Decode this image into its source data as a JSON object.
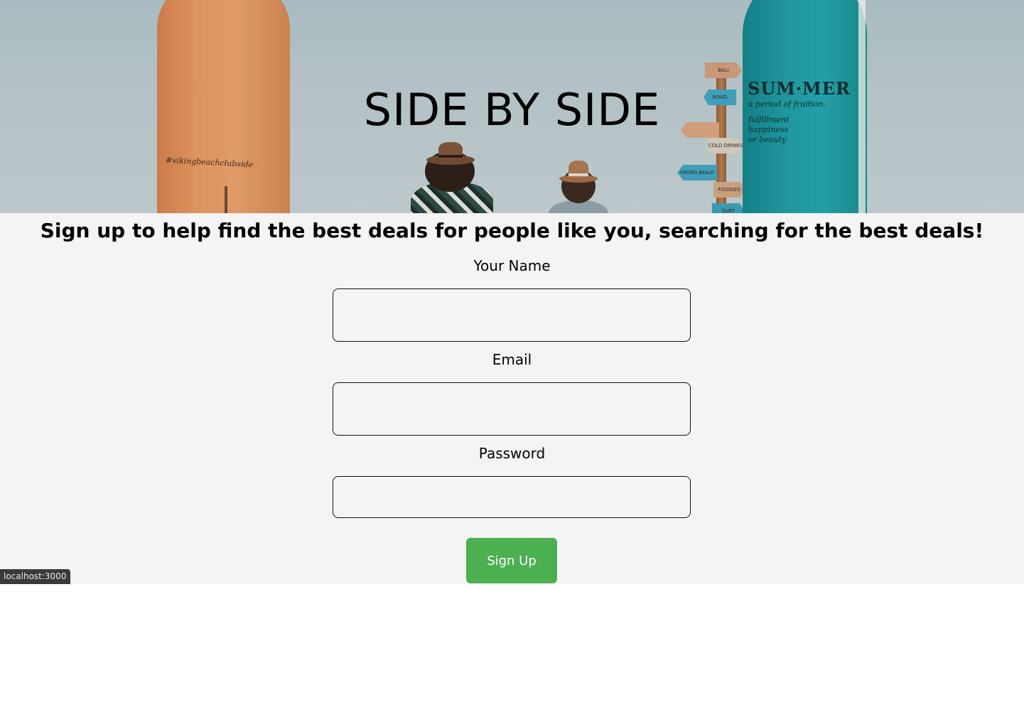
{
  "hero": {
    "title": "SIDE BY SIDE",
    "left_board_text": "#vikingbeachclubside",
    "right_board": {
      "title": "SUM·MER",
      "lines": [
        "a period of fruition.",
        "fulfillment",
        "happiness",
        "or beauty"
      ]
    },
    "signs": [
      "BALI",
      "ROAD",
      "COLD DRINKS",
      "VIKING Beach",
      "FOODIES",
      "SURF"
    ]
  },
  "signup": {
    "tagline": "Sign up to help find the best deals for people like you, searching for the best deals!",
    "name_label": "Your Name",
    "name_value": "",
    "email_label": "Email",
    "email_value": "",
    "password_label": "Password",
    "password_value": "",
    "button_label": "Sign Up"
  },
  "status_bar": {
    "url": "localhost:3000"
  },
  "colors": {
    "page_background": "#f4f4f4",
    "button_green": "#4caf50",
    "text": "#000000"
  }
}
